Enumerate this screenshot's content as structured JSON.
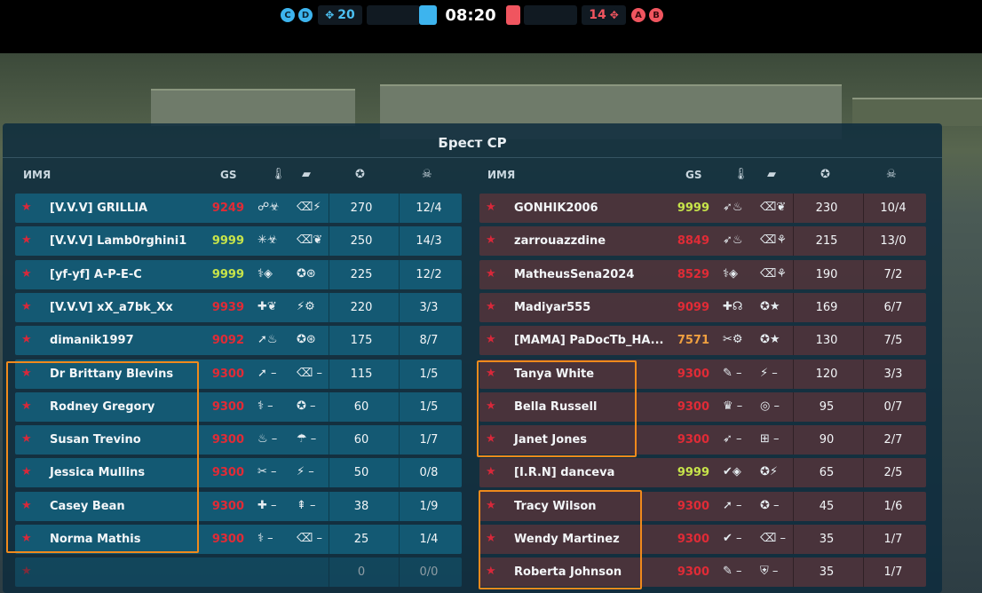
{
  "hud": {
    "left_team_icons": [
      "C",
      "D"
    ],
    "left_count": "20",
    "timer": "08:20",
    "right_count": "14",
    "right_team_icons": [
      "A",
      "B"
    ],
    "blue_color": "#3db4ee",
    "red_color": "#f0555f"
  },
  "panel": {
    "title": "Брест CP"
  },
  "headers": {
    "name": "ИМЯ",
    "gs": "GS",
    "turret_icon": "thermometer-icon",
    "hull_icon": "tank-icon",
    "score_icon": "star-badge-icon",
    "kd_icon": "skull-icon"
  },
  "left_team": [
    {
      "name": "[V.V.V] GRILLIA",
      "gs": "9249",
      "gs_color": "#e02b36",
      "ic1": "☍☣",
      "ic2": "⌫⚡",
      "score": "270",
      "kd": "12/4"
    },
    {
      "name": "[V.V.V] Lamb0rghini1",
      "gs": "9999",
      "gs_color": "#c7e44a",
      "ic1": "✳☣",
      "ic2": "⌫❦",
      "score": "250",
      "kd": "14/3"
    },
    {
      "name": "[yf-yf] A-P-E-C",
      "gs": "9999",
      "gs_color": "#c7e44a",
      "ic1": "⚕◈",
      "ic2": "✪⊛",
      "score": "225",
      "kd": "12/2"
    },
    {
      "name": "[V.V.V] xX_a7bk_Xx",
      "gs": "9939",
      "gs_color": "#e02b36",
      "ic1": "✚❦",
      "ic2": "⚡⚙",
      "score": "220",
      "kd": "3/3"
    },
    {
      "name": "dimanik1997",
      "gs": "9092",
      "gs_color": "#e02b36",
      "ic1": "➚♨",
      "ic2": "✪⊛",
      "score": "175",
      "kd": "8/7"
    },
    {
      "name": "Dr Brittany Blevins",
      "gs": "9300",
      "gs_color": "#e02b36",
      "ic1": "➚ –",
      "ic2": "⌫ –",
      "score": "115",
      "kd": "1/5"
    },
    {
      "name": "Rodney Gregory",
      "gs": "9300",
      "gs_color": "#e02b36",
      "ic1": "⚕ –",
      "ic2": "✪ –",
      "score": "60",
      "kd": "1/5"
    },
    {
      "name": "Susan Trevino",
      "gs": "9300",
      "gs_color": "#e02b36",
      "ic1": "♨ –",
      "ic2": "☂ –",
      "score": "60",
      "kd": "1/7"
    },
    {
      "name": "Jessica Mullins",
      "gs": "9300",
      "gs_color": "#e02b36",
      "ic1": "✂ –",
      "ic2": "⚡ –",
      "score": "50",
      "kd": "0/8"
    },
    {
      "name": "Casey Bean",
      "gs": "9300",
      "gs_color": "#e02b36",
      "ic1": "✚ –",
      "ic2": "⇞ –",
      "score": "38",
      "kd": "1/9"
    },
    {
      "name": "Norma Mathis",
      "gs": "9300",
      "gs_color": "#e02b36",
      "ic1": "⚕ –",
      "ic2": "⌫ –",
      "score": "25",
      "kd": "1/4"
    },
    {
      "name": "",
      "gs": "",
      "gs_color": "#e02b36",
      "ic1": "",
      "ic2": "",
      "score": "0",
      "kd": "0/0"
    }
  ],
  "right_team": [
    {
      "name": "GONHIK2006",
      "gs": "9999",
      "gs_color": "#c7e44a",
      "ic1": "➶♨",
      "ic2": "⌫❦",
      "score": "230",
      "kd": "10/4"
    },
    {
      "name": "zarrouazzdine",
      "gs": "8849",
      "gs_color": "#e02b36",
      "ic1": "➶♨",
      "ic2": "⌫⚘",
      "score": "215",
      "kd": "13/0"
    },
    {
      "name": "MatheusSena2024",
      "gs": "8529",
      "gs_color": "#e02b36",
      "ic1": "⚕◈",
      "ic2": "⌫⚘",
      "score": "190",
      "kd": "7/2"
    },
    {
      "name": "Madiyar555",
      "gs": "9099",
      "gs_color": "#e02b36",
      "ic1": "✚☊",
      "ic2": "✪★",
      "score": "169",
      "kd": "6/7"
    },
    {
      "name": "[MAMA] PaDocTb_HA...",
      "gs": "7571",
      "gs_color": "#f0a040",
      "ic1": "✂⚙",
      "ic2": "✪★",
      "score": "130",
      "kd": "7/5"
    },
    {
      "name": "Tanya White",
      "gs": "9300",
      "gs_color": "#e02b36",
      "ic1": "✎ –",
      "ic2": "⚡ –",
      "score": "120",
      "kd": "3/3"
    },
    {
      "name": "Bella Russell",
      "gs": "9300",
      "gs_color": "#e02b36",
      "ic1": "♛ –",
      "ic2": "◎ –",
      "score": "95",
      "kd": "0/7"
    },
    {
      "name": "Janet Jones",
      "gs": "9300",
      "gs_color": "#e02b36",
      "ic1": "➶ –",
      "ic2": "⊞ –",
      "score": "90",
      "kd": "2/7"
    },
    {
      "name": "[I.R.N] danceva",
      "gs": "9999",
      "gs_color": "#c7e44a",
      "ic1": "✔◈",
      "ic2": "✪⚡",
      "score": "65",
      "kd": "2/5"
    },
    {
      "name": "Tracy Wilson",
      "gs": "9300",
      "gs_color": "#e02b36",
      "ic1": "➚ –",
      "ic2": "✪ –",
      "score": "45",
      "kd": "1/6"
    },
    {
      "name": "Wendy Martinez",
      "gs": "9300",
      "gs_color": "#e02b36",
      "ic1": "✔ –",
      "ic2": "⌫ –",
      "score": "35",
      "kd": "1/7"
    },
    {
      "name": "Roberta Johnson",
      "gs": "9300",
      "gs_color": "#e02b36",
      "ic1": "✎ –",
      "ic2": "⛨ –",
      "score": "35",
      "kd": "1/7"
    }
  ]
}
